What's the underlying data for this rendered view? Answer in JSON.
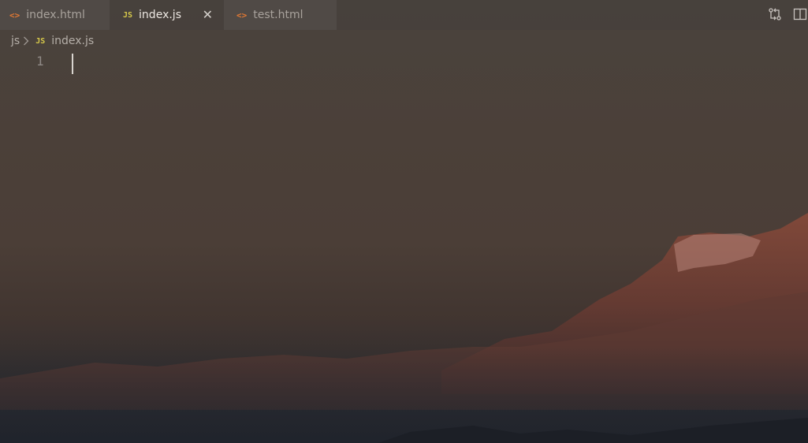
{
  "tabs": [
    {
      "label": "index.html",
      "icon": "html-file-icon",
      "glyph": "<>",
      "active": false
    },
    {
      "label": "index.js",
      "icon": "js-file-icon",
      "glyph": "JS",
      "active": true
    },
    {
      "label": "test.html",
      "icon": "html-file-icon",
      "glyph": "<>",
      "active": false
    }
  ],
  "close_glyph": "✕",
  "breadcrumb": {
    "folder": "js",
    "file_glyph": "JS",
    "file": "index.js"
  },
  "editor": {
    "line_numbers": [
      "1"
    ]
  },
  "colors": {
    "html_icon": "#e37933",
    "js_icon": "#d6c84a",
    "active_tab_text": "#ece7e2"
  },
  "toolbar": {
    "icons": [
      "source-control-compare-icon",
      "split-editor-icon"
    ]
  }
}
